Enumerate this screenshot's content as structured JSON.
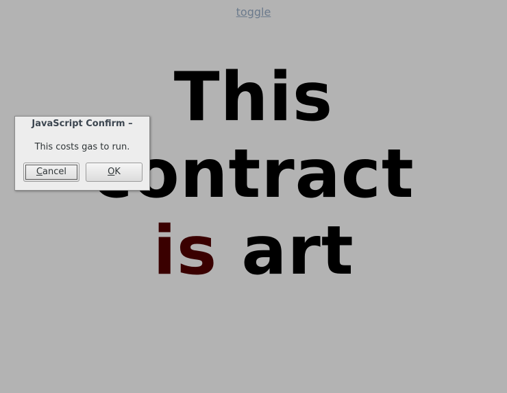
{
  "page": {
    "toggle_label": "toggle",
    "headline": {
      "line1": "This",
      "line2": "contract",
      "line3_accent": "is",
      "line3_rest": "art"
    }
  },
  "dialog": {
    "title": "JavaScript Confirm –",
    "message": "This costs gas to run.",
    "cancel_mnemonic": "C",
    "cancel_rest": "ancel",
    "ok_mnemonic": "O",
    "ok_rest": "K"
  },
  "colors": {
    "background": "#b3b3b3",
    "headline": "#000000",
    "accent": "#3a0000",
    "link": "#6b7a8c"
  }
}
